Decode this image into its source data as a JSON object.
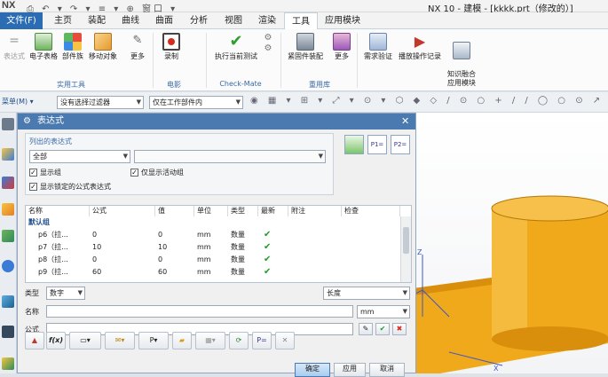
{
  "app": {
    "logo": "NX",
    "title": "NX 10 - 建模 - [kkkk.prt（修改的）]",
    "quick_access": "⎙ ↶ ▾ ↷ ▾ ≡ ▾ ⊕ 窗口 ▾"
  },
  "tabs": [
    "文件(F)",
    "主页",
    "装配",
    "曲线",
    "曲面",
    "分析",
    "视图",
    "渲染",
    "工具",
    "应用模块"
  ],
  "ribbon": {
    "buttons": [
      {
        "label": "表达式"
      },
      {
        "label": "电子表格"
      },
      {
        "label": "部件族"
      },
      {
        "label": "移动对象"
      },
      {
        "label": "更多"
      },
      {
        "label": "录制"
      },
      {
        "label": "执行当前测试"
      },
      {
        "label": "紧固件装配"
      },
      {
        "label": "更多"
      },
      {
        "label": "需求验证"
      },
      {
        "label": "播放操作记录"
      },
      {
        "label": "知识融合\n应用模块"
      }
    ],
    "groups": [
      "实用工具",
      "电影",
      "Check-Mate",
      "重用库"
    ]
  },
  "filterbar": {
    "menu": "菜单(M) ▾",
    "filter1": "没有选择过滤器",
    "filter2": "仅在工作部件内"
  },
  "dialog": {
    "title": "表达式",
    "list_label": "列出的表达式",
    "list_value": "全部",
    "show_groups": "显示组",
    "show_active_only": "仅显示活动组",
    "show_locked": "显示锁定的公式表达式",
    "columns": [
      "名称",
      "公式",
      "值",
      "单位",
      "类型",
      "最新",
      "附注",
      "检查"
    ],
    "group_row": "默认组",
    "rows": [
      {
        "name": "p6（拉...",
        "formula": "0",
        "value": "0",
        "unit": "mm",
        "type": "数量"
      },
      {
        "name": "p7（拉...",
        "formula": "10",
        "value": "10",
        "unit": "mm",
        "type": "数量"
      },
      {
        "name": "p8（拉...",
        "formula": "0",
        "value": "0",
        "unit": "mm",
        "type": "数量"
      },
      {
        "name": "p9（拉...",
        "formula": "60",
        "value": "60",
        "unit": "mm",
        "type": "数量"
      }
    ],
    "type_label": "类型",
    "type_value": "数字",
    "dimension_value": "长度",
    "name_label": "名称",
    "unit_value": "mm",
    "formula_label": "公式",
    "fx_label": "f(x)",
    "ok": "确定",
    "apply": "应用",
    "cancel": "取消"
  },
  "colors": {
    "file_tab": "#2b6cb3",
    "dialog_title": "#4a7ab0",
    "cylinder": "#f0a91a",
    "check": "#1e9d2a"
  }
}
